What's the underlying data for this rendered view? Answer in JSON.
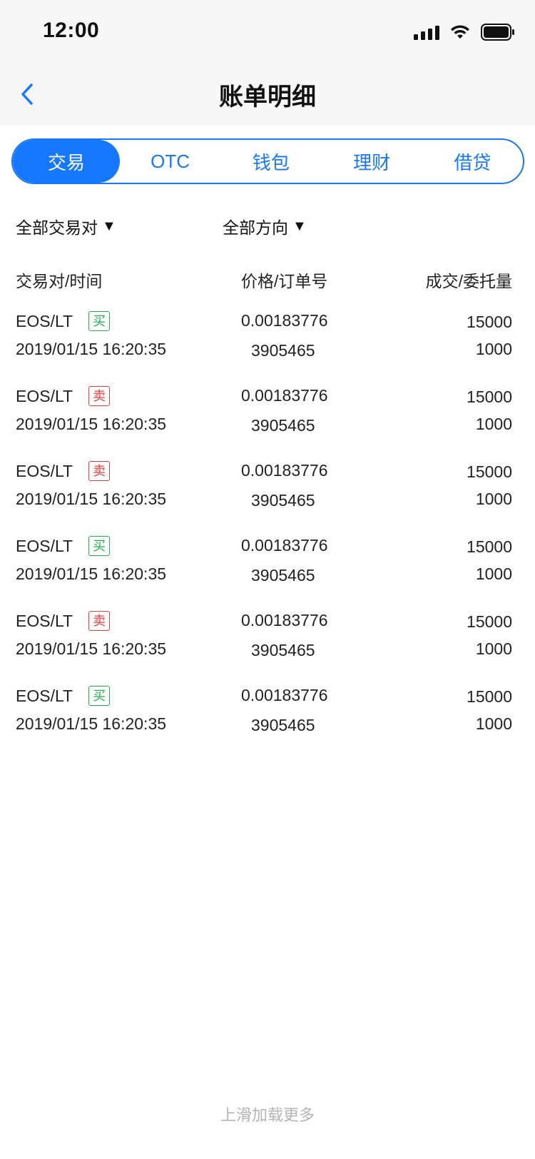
{
  "status_bar": {
    "time": "12:00"
  },
  "nav": {
    "title": "账单明细"
  },
  "tabs": [
    {
      "label": "交易",
      "active": true
    },
    {
      "label": "OTC",
      "active": false
    },
    {
      "label": "钱包",
      "active": false
    },
    {
      "label": "理财",
      "active": false
    },
    {
      "label": "借贷",
      "active": false
    }
  ],
  "filters": {
    "pair": "全部交易对",
    "direction": "全部方向",
    "caret": "▼"
  },
  "table": {
    "headers": [
      "交易对/时间",
      "价格/订单号",
      "成交/委托量"
    ],
    "rows": [
      {
        "pair": "EOS/LT",
        "side": "买",
        "side_type": "buy",
        "time": "2019/01/15 16:20:35",
        "price": "0.00183776",
        "order": "3905465",
        "filled": "15000",
        "total": "1000"
      },
      {
        "pair": "EOS/LT",
        "side": "卖",
        "side_type": "sell",
        "time": "2019/01/15 16:20:35",
        "price": "0.00183776",
        "order": "3905465",
        "filled": "15000",
        "total": "1000"
      },
      {
        "pair": "EOS/LT",
        "side": "卖",
        "side_type": "sell",
        "time": "2019/01/15 16:20:35",
        "price": "0.00183776",
        "order": "3905465",
        "filled": "15000",
        "total": "1000"
      },
      {
        "pair": "EOS/LT",
        "side": "买",
        "side_type": "buy",
        "time": "2019/01/15 16:20:35",
        "price": "0.00183776",
        "order": "3905465",
        "filled": "15000",
        "total": "1000"
      },
      {
        "pair": "EOS/LT",
        "side": "卖",
        "side_type": "sell",
        "time": "2019/01/15 16:20:35",
        "price": "0.00183776",
        "order": "3905465",
        "filled": "15000",
        "total": "1000"
      },
      {
        "pair": "EOS/LT",
        "side": "买",
        "side_type": "buy",
        "time": "2019/01/15 16:20:35",
        "price": "0.00183776",
        "order": "3905465",
        "filled": "15000",
        "total": "1000"
      }
    ]
  },
  "footer": {
    "load_more": "上滑加载更多"
  },
  "colors": {
    "accent": "#1677ff",
    "buy": "#22b04b",
    "sell": "#ef3b3b"
  }
}
